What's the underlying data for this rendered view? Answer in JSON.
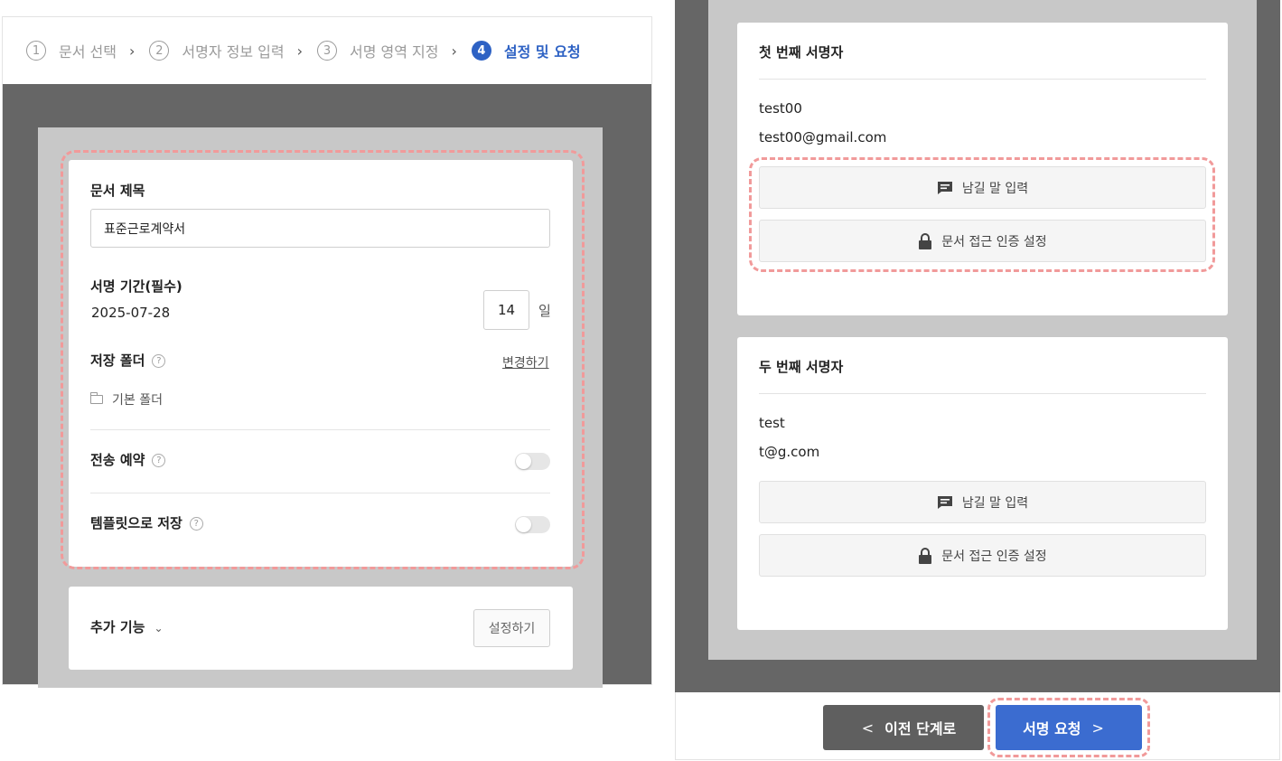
{
  "stepper": {
    "steps": [
      {
        "num": "1",
        "label": "문서 선택"
      },
      {
        "num": "2",
        "label": "서명자 정보 입력"
      },
      {
        "num": "3",
        "label": "서명 영역 지정"
      },
      {
        "num": "4",
        "label": "설정 및 요청"
      }
    ],
    "active_step": 4
  },
  "settings": {
    "doc_title_label": "문서 제목",
    "doc_title_value": "표준근로계약서",
    "sign_period_label": "서명 기간(필수)",
    "sign_period_date": "2025-07-28",
    "sign_period_days": "14",
    "sign_period_unit": "일",
    "folder_label": "저장 폴더",
    "folder_change": "변경하기",
    "folder_name": "기본 폴더",
    "schedule_label": "전송 예약",
    "schedule_enabled": false,
    "template_label": "템플릿으로 저장",
    "template_enabled": false,
    "help_icon_text": "?"
  },
  "extra": {
    "label": "추가 기능",
    "chevron": "⌄",
    "button": "설정하기"
  },
  "signers": [
    {
      "title": "첫 번째 서명자",
      "name": "test00",
      "email": "test00@gmail.com",
      "message_button": "남길 말 입력",
      "auth_button": "문서 접근 인증 설정"
    },
    {
      "title": "두 번째 서명자",
      "name": "test",
      "email": "t@g.com",
      "message_button": "남길 말 입력",
      "auth_button": "문서 접근 인증 설정"
    }
  ],
  "footer": {
    "prev_label": "이전 단계로",
    "prev_chevron": "<",
    "submit_label": "서명 요청",
    "submit_chevron": ">"
  },
  "colors": {
    "accent": "#3b6cd0",
    "highlight_dash": "#f19a9a",
    "backdrop": "#666666"
  }
}
